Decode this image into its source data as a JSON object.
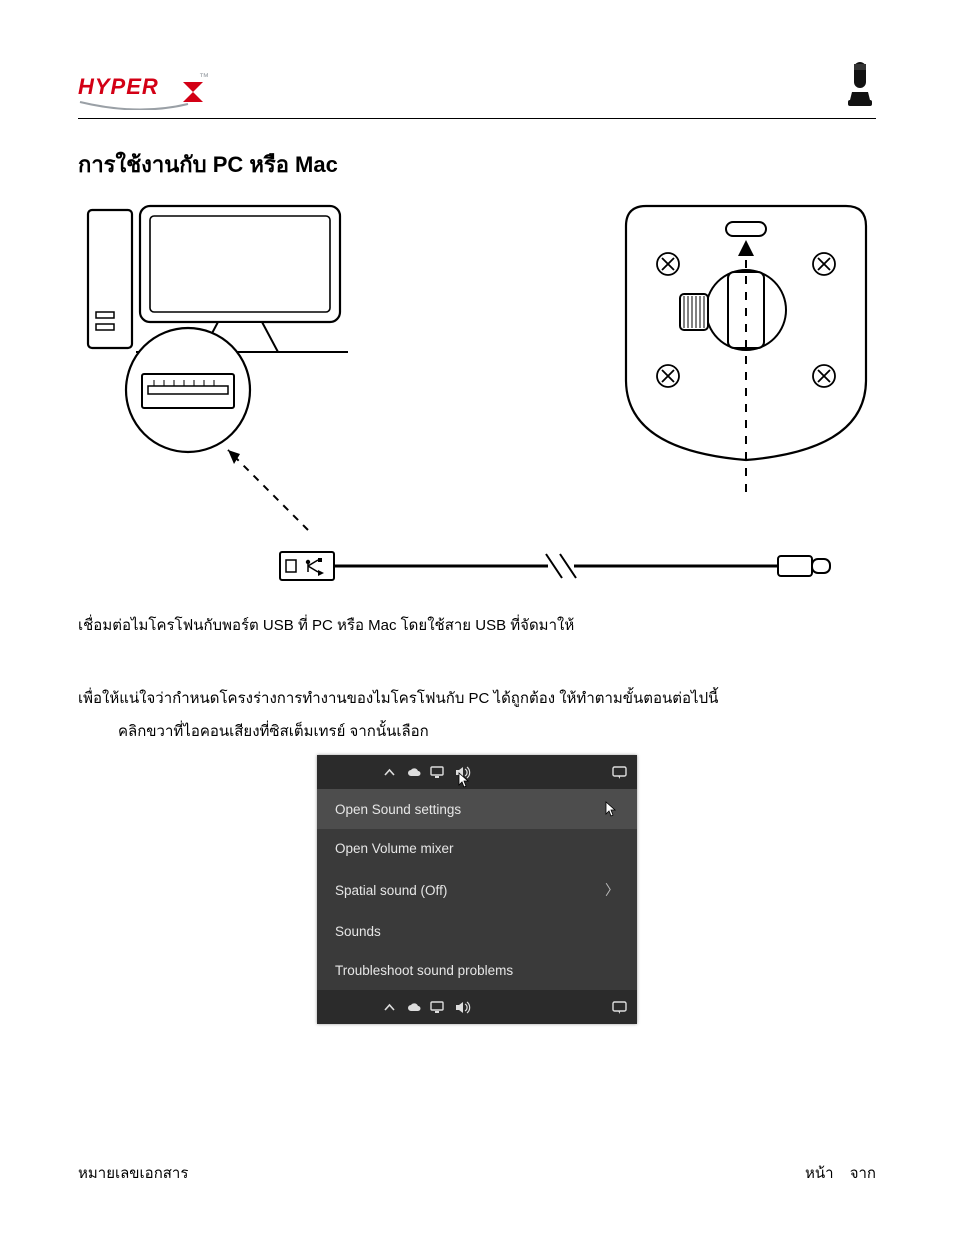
{
  "brand": "HYPERX",
  "heading": "การใช้งานกับ PC หรือ Mac",
  "paragraph1": "เชื่อมต่อไมโครโฟนกับพอร์ต USB ที่ PC หรือ Mac โดยใช้สาย USB ที่จัดมาให้",
  "paragraph2": "เพื่อให้แน่ใจว่ากำหนดโครงร่างการทำงานของไมโครโฟนกับ PC ได้ถูกต้อง ให้ทำตามขั้นตอนต่อไปนี้",
  "paragraph3": "คลิกขวาที่ไอคอนเสียงที่ซิสเต็มเทรย์ จากนั้นเลือก",
  "menu": {
    "items": [
      "Open Sound settings",
      "Open Volume mixer",
      "Spatial sound (Off)",
      "Sounds",
      "Troubleshoot sound problems"
    ]
  },
  "footer": {
    "doc_number_label": "หมายเลขเอกสาร",
    "page_label": "หน้า",
    "of_label": "จาก"
  }
}
